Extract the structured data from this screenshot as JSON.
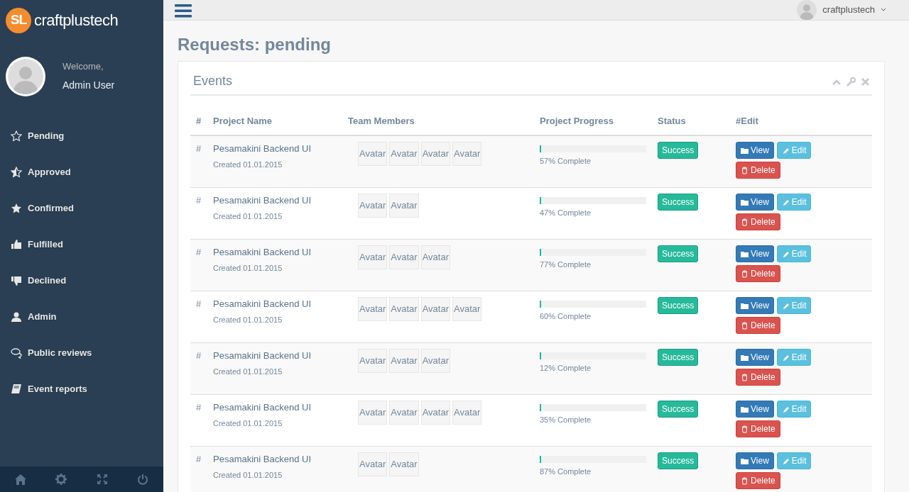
{
  "brand": {
    "logo": "SL",
    "name": "craftplustech"
  },
  "profile": {
    "greeting": "Welcome,",
    "name": "Admin User"
  },
  "sidebar": {
    "items": [
      {
        "label": "Pending",
        "kind": "star-outline"
      },
      {
        "label": "Approved",
        "kind": "star-half"
      },
      {
        "label": "Confirmed",
        "kind": "star"
      },
      {
        "label": "Fulfilled",
        "kind": "thumbs-up"
      },
      {
        "label": "Declined",
        "kind": "thumbs-down"
      },
      {
        "label": "Admin",
        "kind": "user"
      },
      {
        "label": "Public reviews",
        "kind": "comments"
      },
      {
        "label": "Event reports",
        "kind": "book"
      }
    ]
  },
  "topbar": {
    "user": "craftplustech"
  },
  "page_title": "Requests: pending",
  "panel": {
    "title": "Events",
    "table": {
      "columns": [
        "#",
        "Project Name",
        "Team Members",
        "Project Progress",
        "Status",
        "#Edit"
      ],
      "rows": [
        {
          "index": "#",
          "project": "Pesamakini Backend UI",
          "created": "Created 01.01.2015",
          "members": [
            "Avatar",
            "Avatar",
            "Avatar",
            "Avatar"
          ],
          "level": 0.01,
          "progress_text": "57% Complete",
          "status": "Success",
          "actions": [
            {
              "label": "View",
              "kind": "view"
            },
            {
              "label": "Edit",
              "kind": "edit"
            },
            {
              "label": "Delete",
              "kind": "delete"
            }
          ]
        },
        {
          "index": "#",
          "project": "Pesamakini Backend UI",
          "created": "Created 01.01.2015",
          "members": [
            "Avatar",
            "Avatar"
          ],
          "level": 0.01,
          "progress_text": "47% Complete",
          "status": "Success",
          "actions": [
            {
              "label": "View",
              "kind": "view"
            },
            {
              "label": "Edit",
              "kind": "edit"
            },
            {
              "label": "Delete",
              "kind": "delete"
            }
          ]
        },
        {
          "index": "#",
          "project": "Pesamakini Backend UI",
          "created": "Created 01.01.2015",
          "members": [
            "Avatar",
            "Avatar",
            "Avatar"
          ],
          "level": 0.01,
          "progress_text": "77% Complete",
          "status": "Success",
          "actions": [
            {
              "label": "View",
              "kind": "view"
            },
            {
              "label": "Edit",
              "kind": "edit"
            },
            {
              "label": "Delete",
              "kind": "delete"
            }
          ]
        },
        {
          "index": "#",
          "project": "Pesamakini Backend UI",
          "created": "Created 01.01.2015",
          "members": [
            "Avatar",
            "Avatar",
            "Avatar",
            "Avatar"
          ],
          "level": 0.01,
          "progress_text": "60% Complete",
          "status": "Success",
          "actions": [
            {
              "label": "View",
              "kind": "view"
            },
            {
              "label": "Edit",
              "kind": "edit"
            },
            {
              "label": "Delete",
              "kind": "delete"
            }
          ]
        },
        {
          "index": "#",
          "project": "Pesamakini Backend UI",
          "created": "Created 01.01.2015",
          "members": [
            "Avatar",
            "Avatar",
            "Avatar"
          ],
          "level": 0.01,
          "progress_text": "12% Complete",
          "status": "Success",
          "actions": [
            {
              "label": "View",
              "kind": "view"
            },
            {
              "label": "Edit",
              "kind": "edit"
            },
            {
              "label": "Delete",
              "kind": "delete"
            }
          ]
        },
        {
          "index": "#",
          "project": "Pesamakini Backend UI",
          "created": "Created 01.01.2015",
          "members": [
            "Avatar",
            "Avatar",
            "Avatar",
            "Avatar"
          ],
          "level": 0.01,
          "progress_text": "35% Complete",
          "status": "Success",
          "actions": [
            {
              "label": "View",
              "kind": "view"
            },
            {
              "label": "Edit",
              "kind": "edit"
            },
            {
              "label": "Delete",
              "kind": "delete"
            }
          ]
        },
        {
          "index": "#",
          "project": "Pesamakini Backend UI",
          "created": "Created 01.01.2015",
          "members": [
            "Avatar",
            "Avatar"
          ],
          "level": 0.01,
          "progress_text": "87% Complete",
          "status": "Success",
          "actions": [
            {
              "label": "View",
              "kind": "view"
            },
            {
              "label": "Edit",
              "kind": "edit"
            },
            {
              "label": "Delete",
              "kind": "delete"
            }
          ]
        }
      ]
    }
  }
}
